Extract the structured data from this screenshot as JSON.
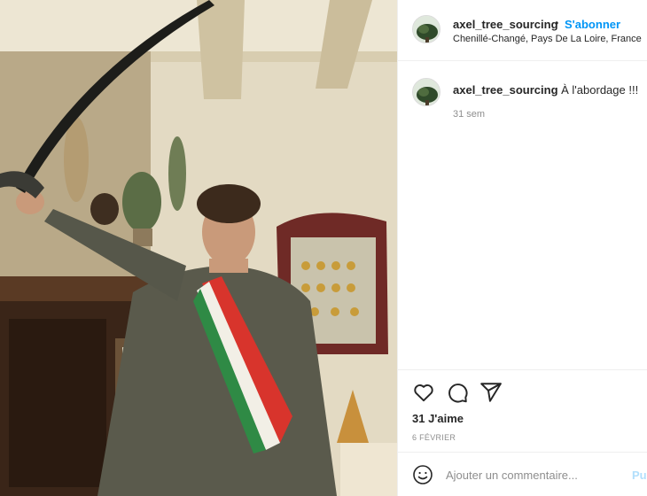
{
  "post": {
    "photo_description_icon": "photo",
    "owner": {
      "username": "axel_tree_sourcing",
      "separator": "•",
      "follow_label": "S'abonner",
      "location": "Chenillé-Changé, Pays De La Loire, France"
    },
    "caption": {
      "username": "axel_tree_sourcing",
      "text": "À l'abordage !!!",
      "time": "31 sem"
    },
    "actions": {
      "like_icon": "heart-icon",
      "comment_icon": "comment-icon",
      "share_icon": "share-icon"
    },
    "likes_text": "31 J'aime",
    "date_text": "6 FÉVRIER",
    "add_comment": {
      "emoji_icon": "emoji-icon",
      "placeholder": "Ajouter un commentaire...",
      "publish_label": "Pu"
    }
  },
  "colors": {
    "link_blue": "#0095f6",
    "publish_disabled": "#b2dffc",
    "muted": "#8e8e8e",
    "text": "#262626",
    "border": "#efefef"
  }
}
